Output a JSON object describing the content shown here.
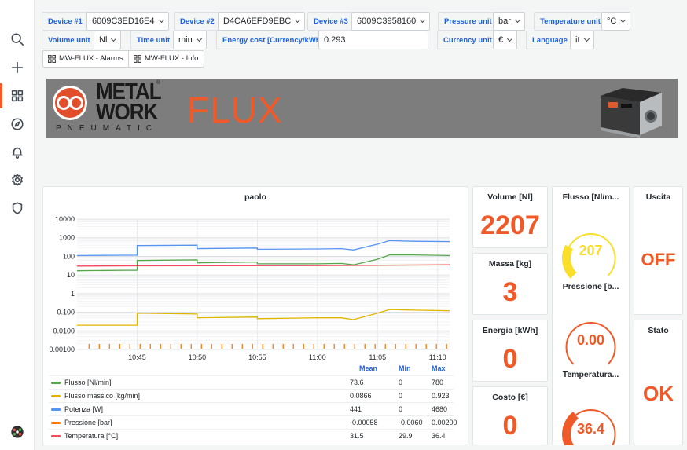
{
  "sidebar": {
    "icons": [
      "search-icon",
      "plus-icon",
      "dashboards-icon",
      "explore-icon",
      "alerting-bell-icon",
      "settings-gear-icon",
      "shield-icon",
      "user-avatar"
    ]
  },
  "variables": {
    "device1": {
      "label": "Device #1",
      "value": "6009C3ED16E4"
    },
    "device2": {
      "label": "Device #2",
      "value": "D4CA6EFD9EBC"
    },
    "device3": {
      "label": "Device #3",
      "value": "6009C3958160"
    },
    "pressure_unit": {
      "label": "Pressure unit",
      "value": "bar"
    },
    "temperature_unit": {
      "label": "Temperature unit",
      "value": "°C"
    },
    "volume_unit": {
      "label": "Volume unit",
      "value": "Nl"
    },
    "time_unit": {
      "label": "Time unit",
      "value": "min"
    },
    "energy_cost": {
      "label": "Energy cost [Currency/kWh]",
      "value": "0.293"
    },
    "currency_unit": {
      "label": "Currency unit",
      "value": "€"
    },
    "language": {
      "label": "Language",
      "value": "it"
    }
  },
  "links": {
    "alarms": "MW-FLUX - Alarms",
    "info": "MW-FLUX - Info"
  },
  "banner": {
    "brand": "FLUX",
    "logo_line1": "METAL",
    "logo_line2": "WORK",
    "logo_line3": "PNEUMATIC",
    "logo_reg": "®"
  },
  "chart_panel": {
    "title": "paolo",
    "legend_headers": {
      "mean": "Mean",
      "min": "Min",
      "max": "Max"
    }
  },
  "chart_data": {
    "type": "line",
    "title": "paolo",
    "y_scale": "log",
    "ylim": [
      0.001,
      10000
    ],
    "y_ticks": [
      "10000",
      "1000",
      "100",
      "10",
      "1",
      "0.100",
      "0.0100",
      "0.00100"
    ],
    "x_ticks": [
      "10:45",
      "10:50",
      "10:55",
      "11:00",
      "11:05",
      "11:10"
    ],
    "xlim": [
      "10:40",
      "11:11"
    ],
    "grid": true,
    "legend_placement": "bottom-table",
    "series": [
      {
        "name": "Flusso [Nl/min]",
        "color": "#56a64b",
        "mean": "73.6",
        "min": "0",
        "max": "780",
        "x": [
          "10:40",
          "10:44",
          "10:45",
          "10:45",
          "10:50",
          "10:50",
          "10:55",
          "10:55",
          "11:00",
          "11:02",
          "11:03",
          "11:05",
          "11:06",
          "11:08",
          "11:11"
        ],
        "y": [
          17,
          18,
          18,
          60,
          65,
          45,
          50,
          40,
          40,
          42,
          35,
          70,
          120,
          120,
          110
        ]
      },
      {
        "name": "Flusso massico [kg/min]",
        "color": "#e0b400",
        "mean": "0.0866",
        "min": "0",
        "max": "0.923",
        "x": [
          "10:40",
          "10:44",
          "10:45",
          "10:45",
          "10:50",
          "10:50",
          "10:55",
          "10:55",
          "11:00",
          "11:02",
          "11:03",
          "11:05",
          "11:06",
          "11:08",
          "11:11"
        ],
        "y": [
          0.02,
          0.02,
          0.02,
          0.09,
          0.08,
          0.05,
          0.055,
          0.045,
          0.05,
          0.05,
          0.04,
          0.09,
          0.14,
          0.13,
          0.12
        ]
      },
      {
        "name": "Potenza [W]",
        "color": "#5794f2",
        "mean": "441",
        "min": "0",
        "max": "4680",
        "x": [
          "10:40",
          "10:44",
          "10:45",
          "10:45",
          "10:50",
          "10:50",
          "10:55",
          "10:55",
          "11:00",
          "11:02",
          "11:03",
          "11:05",
          "11:06",
          "11:08",
          "11:11"
        ],
        "y": [
          110,
          115,
          115,
          380,
          400,
          260,
          280,
          240,
          250,
          260,
          220,
          450,
          700,
          650,
          620
        ]
      },
      {
        "name": "Pressione [bar]",
        "color": "#ff780a",
        "mean": "-0.00058",
        "min": "-0.0060",
        "max": "0.00200",
        "x": [
          "10:40",
          "11:11"
        ],
        "y": [
          0.002,
          0.002
        ]
      },
      {
        "name": "Temperatura [°C]",
        "color": "#f2495c",
        "mean": "31.5",
        "min": "29.9",
        "max": "36.4",
        "x": [
          "10:40",
          "10:45",
          "11:00",
          "11:11"
        ],
        "y": [
          30,
          31,
          32,
          35
        ]
      }
    ]
  },
  "stats": {
    "volume": {
      "title": "Volume [Nl]",
      "value": "2207"
    },
    "massa": {
      "title": "Massa [kg]",
      "value": "3"
    },
    "energia": {
      "title": "Energia [kWh]",
      "value": "0"
    },
    "costo": {
      "title": "Costo [€]",
      "value": "0"
    },
    "uscita": {
      "title": "Uscita",
      "value": "OFF"
    },
    "stato": {
      "title": "Stato",
      "value": "OK"
    }
  },
  "gauges": {
    "flusso": {
      "title": "Flusso [Nl/m...",
      "value": "207",
      "level": 0.27,
      "color": "#fade2a"
    },
    "pressione": {
      "title": "Pressione [b...",
      "value": "0.00",
      "level": 0.0,
      "color": "#f05a28"
    },
    "temperatura": {
      "title": "Temperatura...",
      "value": "36.4",
      "level": 0.36,
      "color": "#f05a28"
    }
  },
  "colors": {
    "accent": "#f05a28",
    "link_label": "#1f62e0",
    "banner": "#7d7d7d"
  }
}
